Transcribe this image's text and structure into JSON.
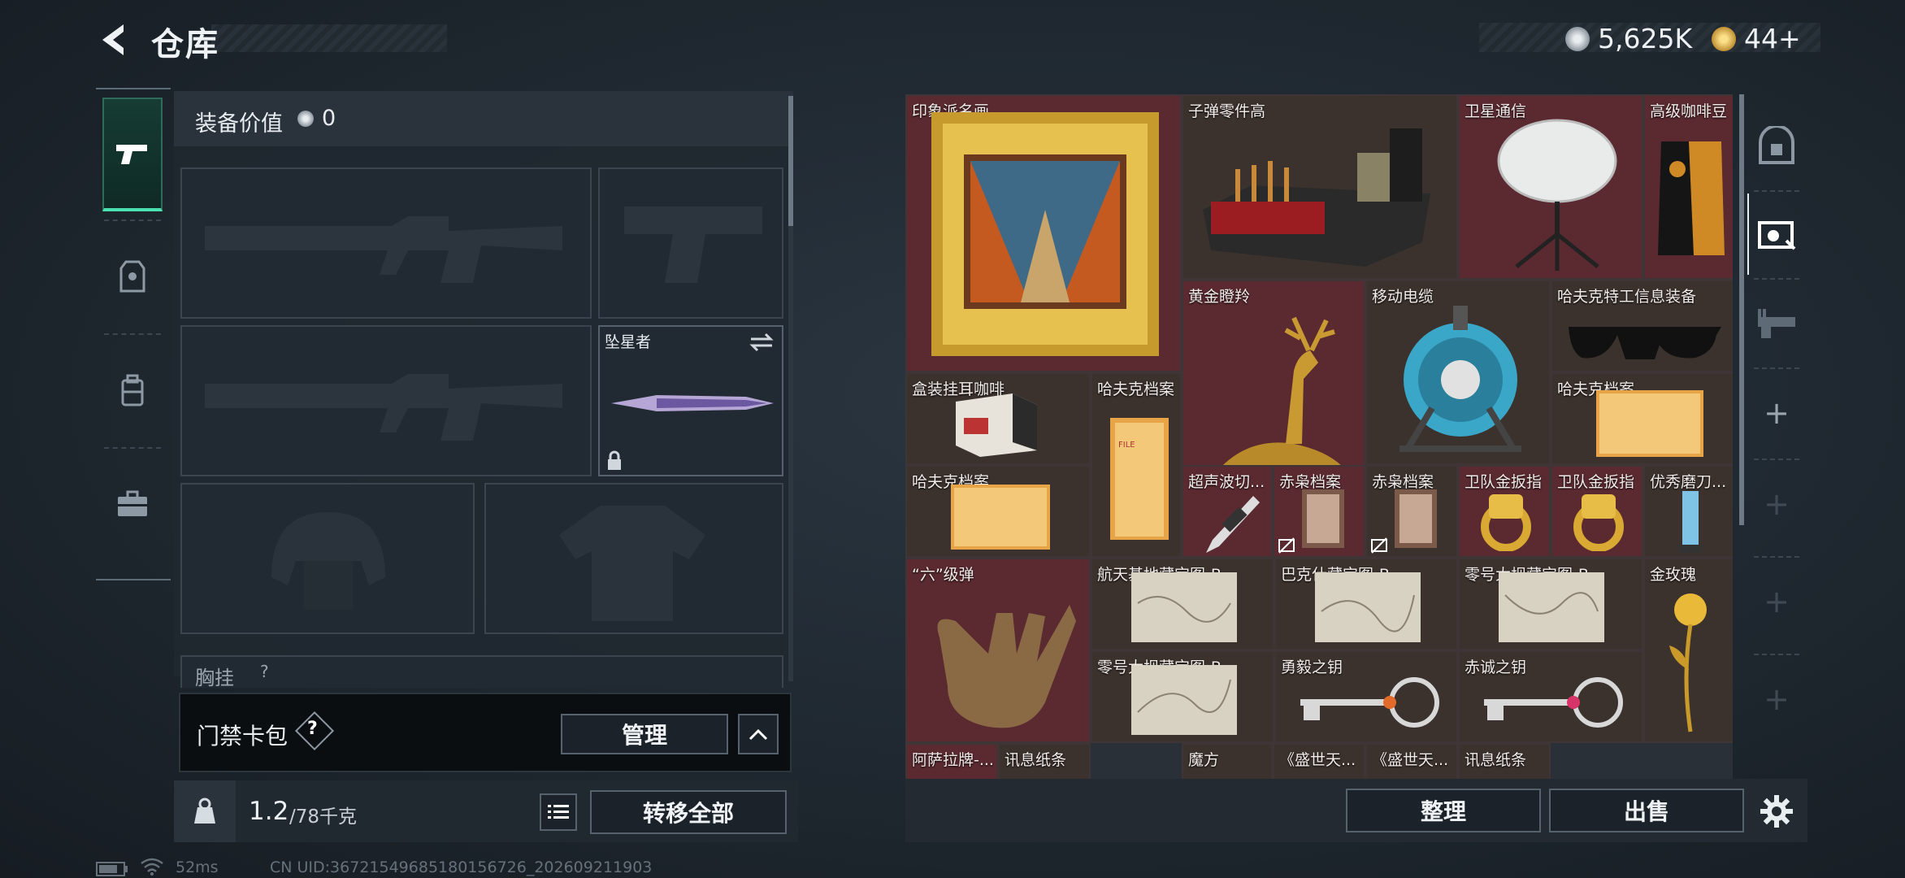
{
  "header": {
    "title": "仓库",
    "currency_silver": "5,625K",
    "currency_gold": "44+"
  },
  "equip": {
    "value_label": "装备价值",
    "value": "0",
    "melee_name": "坠星者",
    "chest_label": "胸挂",
    "chest_help": "?"
  },
  "cardbag": {
    "label": "门禁卡包",
    "help": "?",
    "manage": "管理"
  },
  "weight": {
    "current": "1.2",
    "max": "/78千克",
    "transfer_all": "转移全部"
  },
  "storage": {
    "items": [
      {
        "label": "印象派名画"
      },
      {
        "label": "子弹零件高"
      },
      {
        "label": "卫星通信"
      },
      {
        "label": "高级咖啡豆"
      },
      {
        "label": "黄金瞪羚"
      },
      {
        "label": "移动电缆"
      },
      {
        "label": "哈夫克特工信息装备"
      },
      {
        "label": "盒装挂耳咖啡"
      },
      {
        "label": "哈夫克档案"
      },
      {
        "label": "哈夫克档案"
      },
      {
        "label": "哈夫克档案"
      },
      {
        "label": "超声波切..."
      },
      {
        "label": "赤枭档案"
      },
      {
        "label": "赤枭档案"
      },
      {
        "label": "卫队金扳指"
      },
      {
        "label": "卫队金扳指"
      },
      {
        "label": "优秀磨刀..."
      },
      {
        "label": "“六”级弹"
      },
      {
        "label": "航天基地藏宝图-B"
      },
      {
        "label": "巴克什藏宝图-B"
      },
      {
        "label": "零号大坝藏宝图-B"
      },
      {
        "label": "金玫瑰"
      },
      {
        "label": "零号大坝藏宝图-B"
      },
      {
        "label": "勇毅之钥"
      },
      {
        "label": "赤诚之钥"
      },
      {
        "label": "阿萨拉牌-..."
      },
      {
        "label": "讯息纸条"
      },
      {
        "label": "魔方"
      },
      {
        "label": "《盛世天..."
      },
      {
        "label": "《盛世天..."
      },
      {
        "label": "讯息纸条"
      }
    ],
    "sort": "整理",
    "sell": "出售"
  },
  "footer": {
    "ping": "52ms",
    "uid": "CN UID:36721549685180156726_202609211903"
  },
  "colors": {
    "accent_green": "#4be0b0",
    "cell_red": "#5a2a30",
    "cell_brown": "#3b322d"
  }
}
